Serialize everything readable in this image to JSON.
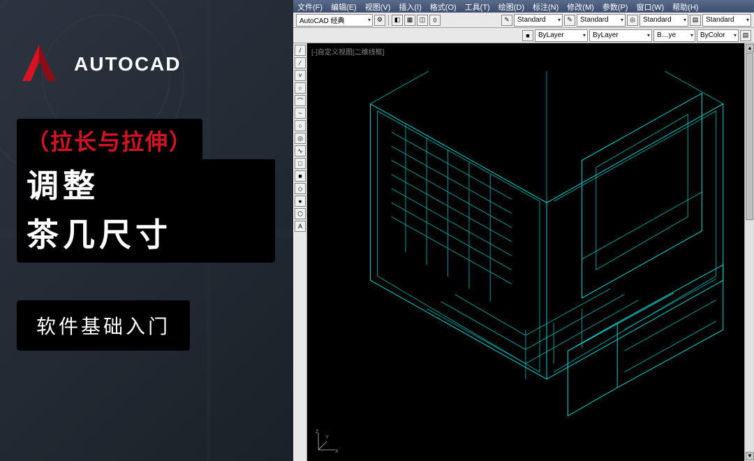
{
  "brand": {
    "name": "AUTOCAD",
    "logo_colors": {
      "accent": "#d41324",
      "shadow": "#8a0c17"
    }
  },
  "banner": {
    "subtitle": "（拉长与拉伸）",
    "title_line1": "调整",
    "title_line2": "茶几尺寸",
    "button_label": "软件基础入门"
  },
  "menubar": [
    "文件(F)",
    "编辑(E)",
    "视图(V)",
    "插入(I)",
    "格式(O)",
    "工具(T)",
    "绘图(D)",
    "标注(N)",
    "修改(M)",
    "参数(P)",
    "窗口(W)",
    "帮助(H)"
  ],
  "toolbar1": {
    "workspace": "AutoCAD 经典",
    "std_groups": [
      {
        "label": "Standard",
        "type": "dropdown"
      },
      {
        "label": "Standard",
        "type": "dropdown"
      },
      {
        "label": "Standard",
        "type": "dropdown"
      },
      {
        "label": "Standard",
        "type": "dropdown"
      }
    ]
  },
  "toolbar2": {
    "layer": "ByLayer",
    "linetype": "ByLayer",
    "lineweight": "B…ye",
    "plot": "ByColor"
  },
  "canvas": {
    "view_label": "[-]自定义视图[二维线框]",
    "ucs": {
      "x": "X",
      "y": "Y",
      "z": "Z"
    }
  },
  "side_tools": [
    "/",
    "∕",
    "˅",
    "○",
    "⌒",
    "~",
    "○",
    "◎",
    "∿",
    "□",
    "■",
    "◇",
    "●",
    "⬡",
    "A"
  ]
}
